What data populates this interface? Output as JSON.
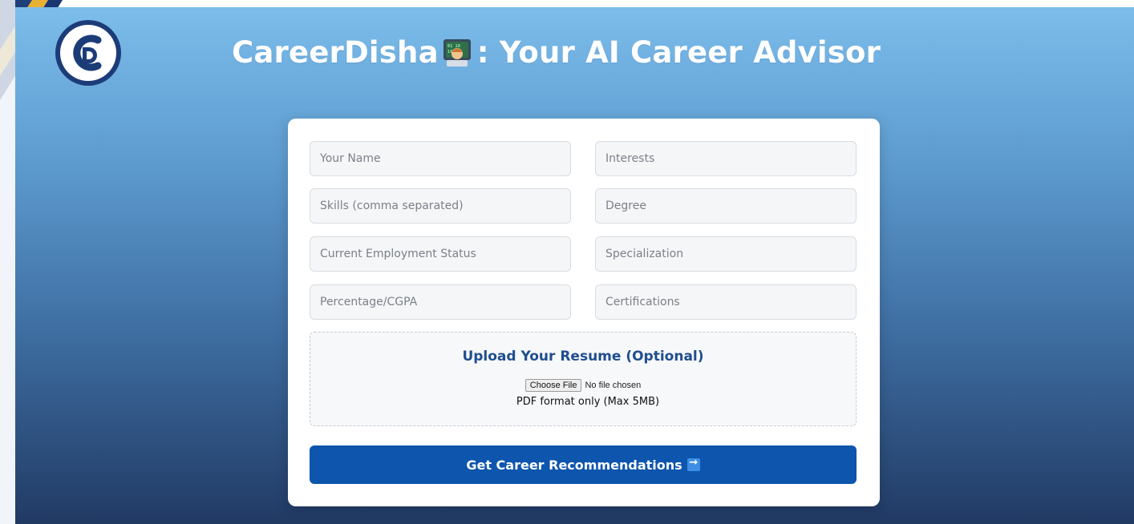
{
  "header": {
    "title_main": "CareerDisha",
    "title_rest": ": Your AI Career Advisor",
    "emoji": "technologist-emoji"
  },
  "form": {
    "fields": {
      "name": "Your Name",
      "interests": "Interests",
      "skills": "Skills (comma separated)",
      "degree": "Degree",
      "employment_status": "Current Employment Status",
      "specialization": "Specialization",
      "percentage": "Percentage/CGPA",
      "certifications": "Certifications"
    },
    "upload": {
      "title": "Upload Your Resume (Optional)",
      "choose_label": "Choose File",
      "status": "No file chosen",
      "note": "PDF format only (Max 5MB)"
    },
    "submit_label": "Get Career Recommendations"
  },
  "colors": {
    "accent": "#0d55ad",
    "upload_title": "#1f4e8f",
    "bg_top": "#7cbdeb",
    "bg_bottom": "#213a64"
  }
}
